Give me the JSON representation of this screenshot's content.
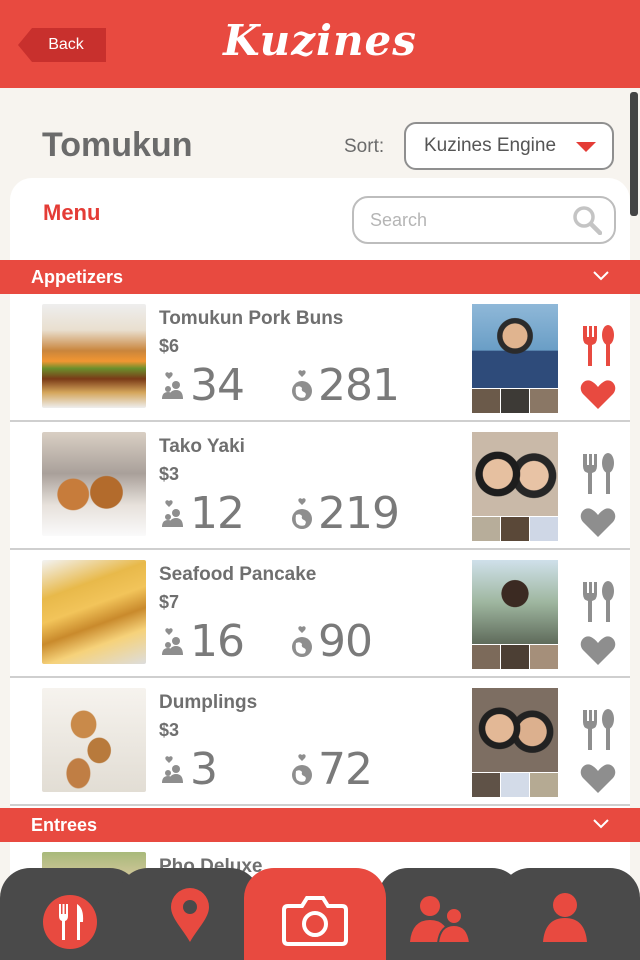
{
  "header": {
    "back_label": "Back",
    "app_title": "Kuzines"
  },
  "restaurant": {
    "name": "Tomukun",
    "sort_label": "Sort:",
    "sort_value": "Kuzines Engine"
  },
  "menu": {
    "heading": "Menu",
    "search_placeholder": "Search"
  },
  "sections": [
    {
      "title": "Appetizers"
    },
    {
      "title": "Entrees"
    }
  ],
  "items": [
    {
      "name": "Tomukun Pork Buns",
      "price": "$6",
      "likes": "34",
      "global": "281",
      "favorited": true
    },
    {
      "name": "Tako Yaki",
      "price": "$3",
      "likes": "12",
      "global": "219",
      "favorited": false
    },
    {
      "name": "Seafood Pancake",
      "price": "$7",
      "likes": "16",
      "global": "90",
      "favorited": false
    },
    {
      "name": "Dumplings",
      "price": "$3",
      "likes": "3",
      "global": "72",
      "favorited": false
    }
  ],
  "partial_item": {
    "name": "Pho Deluxe"
  },
  "colors": {
    "accent": "#e84a40",
    "icon_gray": "#8e8e8e",
    "nav_dark": "#4a4a4a"
  },
  "nav": {
    "tabs": [
      {
        "icon": "menu-fork-knife-icon"
      },
      {
        "icon": "location-pin-icon"
      },
      {
        "icon": "camera-icon",
        "active": true
      },
      {
        "icon": "friends-icon"
      },
      {
        "icon": "profile-icon"
      }
    ]
  }
}
